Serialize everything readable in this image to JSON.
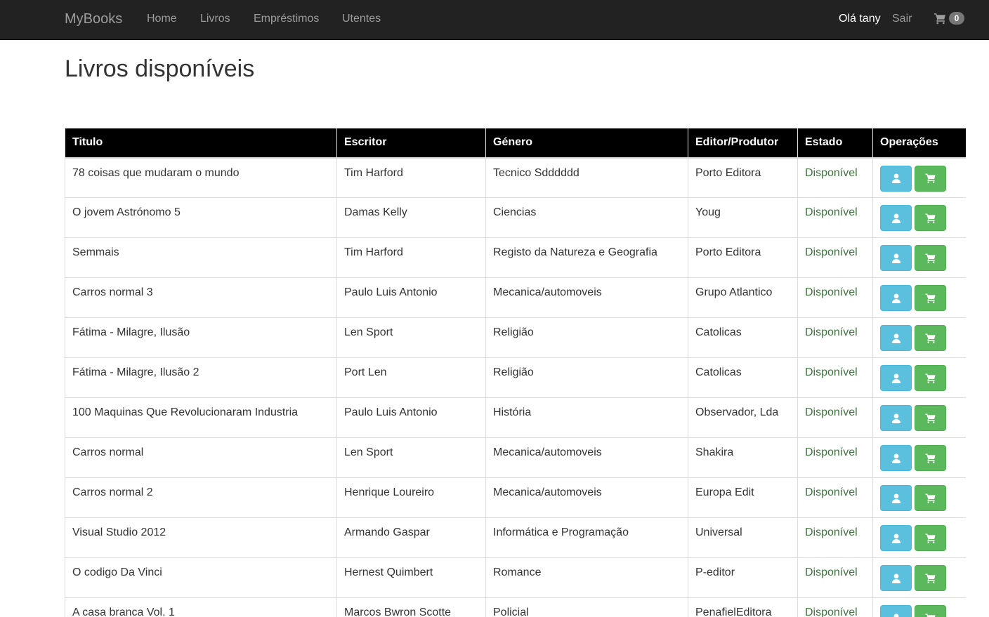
{
  "nav": {
    "brand": "MyBooks",
    "links": [
      "Home",
      "Livros",
      "Empréstimos",
      "Utentes"
    ],
    "greeting": "Olá tany",
    "logout": "Sair",
    "cart_icon": "shopping-cart-icon",
    "cart_count": "0"
  },
  "page_title": "Livros disponíveis",
  "table": {
    "headers": [
      "Titulo",
      "Escritor",
      "Género",
      "Editor/Produtor",
      "Estado",
      "Operações"
    ],
    "op_icons": [
      "user-icon",
      "shopping-cart-icon"
    ],
    "rows": [
      {
        "titulo": "78 coisas que mudaram o mundo",
        "escritor": "Tim Harford",
        "genero": "Tecnico Sdddddd",
        "editor": "Porto Editora",
        "estado": "Disponível"
      },
      {
        "titulo": "O jovem Astrónomo 5",
        "escritor": "Damas Kelly",
        "genero": "Ciencias",
        "editor": "Youg",
        "estado": "Disponível"
      },
      {
        "titulo": "Semmais",
        "escritor": "Tim Harford",
        "genero": "Registo da Natureza e Geografia",
        "editor": "Porto Editora",
        "estado": "Disponível"
      },
      {
        "titulo": "Carros normal 3",
        "escritor": "Paulo Luis Antonio",
        "genero": "Mecanica/automoveis",
        "editor": "Grupo Atlantico",
        "estado": "Disponível"
      },
      {
        "titulo": "Fátima - Milagre, Ilusão",
        "escritor": "Len Sport",
        "genero": "Religião",
        "editor": "Catolicas",
        "estado": "Disponível"
      },
      {
        "titulo": "Fátima - Milagre, Ilusão 2",
        "escritor": "Port Len",
        "genero": "Religião",
        "editor": "Catolicas",
        "estado": "Disponível"
      },
      {
        "titulo": "100 Maquinas Que Revolucionaram Industria",
        "escritor": "Paulo Luis Antonio",
        "genero": "História",
        "editor": "Observador, Lda",
        "estado": "Disponível"
      },
      {
        "titulo": "Carros normal",
        "escritor": "Len Sport",
        "genero": "Mecanica/automoveis",
        "editor": "Shakira",
        "estado": "Disponível"
      },
      {
        "titulo": "Carros normal 2",
        "escritor": "Henrique Loureiro",
        "genero": "Mecanica/automoveis",
        "editor": "Europa Edit",
        "estado": "Disponível"
      },
      {
        "titulo": "Visual Studio 2012",
        "escritor": "Armando Gaspar",
        "genero": "Informática e Programação",
        "editor": "Universal",
        "estado": "Disponível"
      },
      {
        "titulo": "O codigo Da Vinci",
        "escritor": "Hernest Quimbert",
        "genero": "Romance",
        "editor": "P-editor",
        "estado": "Disponível"
      },
      {
        "titulo": "A casa branca Vol. 1",
        "escritor": "Marcos Bwron Scotte",
        "genero": "Policial",
        "editor": "PenafielEditora",
        "estado": "Disponível"
      }
    ]
  },
  "colors": {
    "navbar": "#222222",
    "header_bg": "#000000",
    "status": "#3c763d",
    "btn_info": "#5bc0de",
    "btn_success": "#5cb85c"
  }
}
